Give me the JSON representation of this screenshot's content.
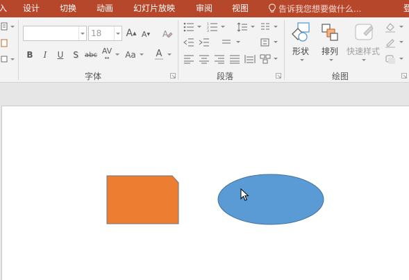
{
  "tabs": {
    "partial_left": "入",
    "design": "设计",
    "transitions": "切换",
    "animations": "动画",
    "slideshow": "幻灯片放映",
    "review": "审阅",
    "view": "视图",
    "partial_right": "登"
  },
  "tell_me": {
    "icon": "lightbulb-icon",
    "placeholder": "告诉我您想要做什么..."
  },
  "font_group": {
    "label": "字体",
    "font_name": "",
    "font_size": "18",
    "buttons": [
      "bold",
      "italic",
      "underline",
      "shadow",
      "strikethrough",
      "character-spacing",
      "change-case",
      "font-color",
      "increase-font-size",
      "decrease-font-size",
      "clear-formatting"
    ]
  },
  "paragraph_group": {
    "label": "段落",
    "buttons": [
      "bullets",
      "numbering",
      "line-spacing",
      "columns",
      "decrease-indent",
      "increase-indent",
      "text-direction",
      "align-text",
      "align-left",
      "center",
      "align-right",
      "justify",
      "distributed",
      "convert-to-smartart"
    ]
  },
  "drawing_group": {
    "label": "绘图",
    "shapes_label": "形状",
    "arrange_label": "排列",
    "quick_styles_label": "快速样式",
    "buttons": [
      "shape-fill",
      "shape-outline",
      "shape-effects"
    ]
  },
  "slide": {
    "shapes": [
      {
        "kind": "snip-corner-rectangle",
        "fill": "#ed7d31",
        "stroke": "#6b7280"
      },
      {
        "kind": "ellipse",
        "fill": "#5b9bd5",
        "stroke": "#41719c"
      }
    ]
  },
  "colors": {
    "tab_bar": "#b7472a",
    "ribbon_bg": "#f3f3f3",
    "workspace_bg": "#e6e6e6",
    "orange_shape": "#ed7d31",
    "blue_shape": "#5b9bd5"
  }
}
